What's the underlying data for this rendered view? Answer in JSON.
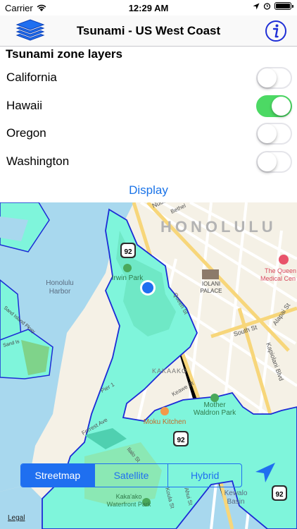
{
  "status": {
    "carrier": "Carrier",
    "time": "12:29 AM"
  },
  "nav": {
    "title": "Tsunami - US West Coast",
    "left_icon": "layers-icon",
    "right_icon": "info-icon"
  },
  "panel": {
    "heading": "Tsunami zone layers",
    "layers": [
      {
        "label": "California",
        "on": false
      },
      {
        "label": "Hawaii",
        "on": true
      },
      {
        "label": "Oregon",
        "on": false
      },
      {
        "label": "Washington",
        "on": false
      }
    ],
    "display_label": "Display"
  },
  "map": {
    "labels": {
      "city": "HONOLULU",
      "harbor": "Honolulu\nHarbor",
      "irwin_park": "Irwin Park",
      "iolani": "IOLANI\nPALACE",
      "queens": "The Queen\nMedical Cen",
      "kakaako": "KAKAAKO",
      "mother_waldron": "Mother\nWaldron Park",
      "moku": "Moku Kitchen",
      "kakaako_park": "Kaka'ako\nWaterfront Park",
      "kewalo": "Kewalo\nBasin",
      "south_st": "South St",
      "kapiolani": "Kapiolani Blvd",
      "alapai": "Alapai St",
      "keawe": "Keawe St",
      "pier1": "Pier 1",
      "forrest": "Forrest Ave",
      "sand_island": "Sand Island Pkwy",
      "ilalo": "Ilalo St",
      "nuuanu": "Nuuanu",
      "bethel": "Bethel",
      "queen_st": "Queen St",
      "koula": "Koula St",
      "ahui": "Ahui St",
      "sandisland_short": "Sand Is",
      "route": "92"
    },
    "mode_options": [
      "Streetmap",
      "Satellite",
      "Hybrid"
    ],
    "active_mode": "Streetmap",
    "legal": "Legal"
  },
  "colors": {
    "accent": "#1f6ff0",
    "toggle_on": "#4cd964",
    "water": "#9fd4ec",
    "zone_fill": "#7ff5db",
    "zone_border": "#1c2bd6",
    "land": "#f5f1e6"
  }
}
